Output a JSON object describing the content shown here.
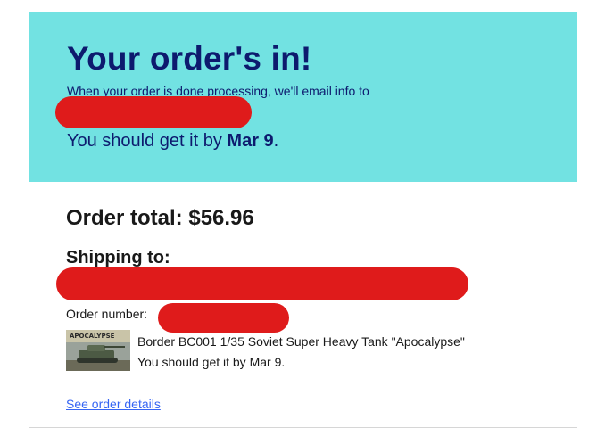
{
  "hero": {
    "title": "Your order's in!",
    "subtitle": "When your order is done processing, we'll email info to",
    "eta_prefix": "You should get it by",
    "eta_date": "Mar 9",
    "eta_suffix": "."
  },
  "order": {
    "total": "Order total: $56.96",
    "shipping_title": "Shipping to:",
    "order_number_label": "Order number: "
  },
  "item": {
    "name": "Border BC001 1/35 Soviet Super Heavy Tank \"Apocalypse\"",
    "eta": "You should get it by Mar 9.",
    "thumb_label": "APOCALYPSE"
  },
  "links": {
    "details": "See order details"
  },
  "colors": {
    "hero_bg": "#72e2e2",
    "hero_text": "#0d1a6e",
    "link": "#3665f3",
    "redaction": "#df1b1b"
  }
}
